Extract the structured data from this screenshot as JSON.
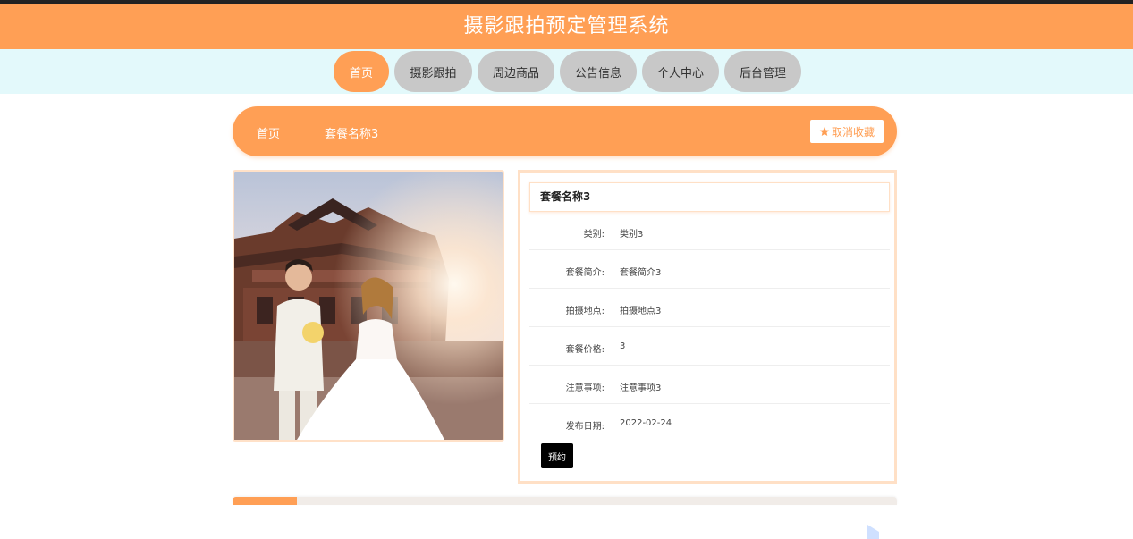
{
  "header": {
    "title": "摄影跟拍预定管理系统"
  },
  "nav": {
    "items": [
      {
        "label": "首页"
      },
      {
        "label": "摄影跟拍"
      },
      {
        "label": "周边商品"
      },
      {
        "label": "公告信息"
      },
      {
        "label": "个人中心"
      },
      {
        "label": "后台管理"
      }
    ]
  },
  "breadcrumb": {
    "home": "首页",
    "current": "套餐名称3",
    "favorite_label": "取消收藏"
  },
  "detail": {
    "title": "套餐名称3",
    "fields": [
      {
        "label": "类别:",
        "value": "类别3"
      },
      {
        "label": "套餐简介:",
        "value": "套餐简介3"
      },
      {
        "label": "拍摄地点:",
        "value": "拍摄地点3"
      },
      {
        "label": "套餐价格:",
        "value": "3"
      },
      {
        "label": "注意事项:",
        "value": "注意事项3"
      },
      {
        "label": "发布日期:",
        "value": "2022-02-24"
      }
    ],
    "book_label": "预约"
  },
  "colors": {
    "accent": "#ff9f55",
    "nav_bg": "#e3f9fb",
    "nav_inactive": "#c8c8c8"
  },
  "icons": {
    "favorite": "star-icon"
  }
}
